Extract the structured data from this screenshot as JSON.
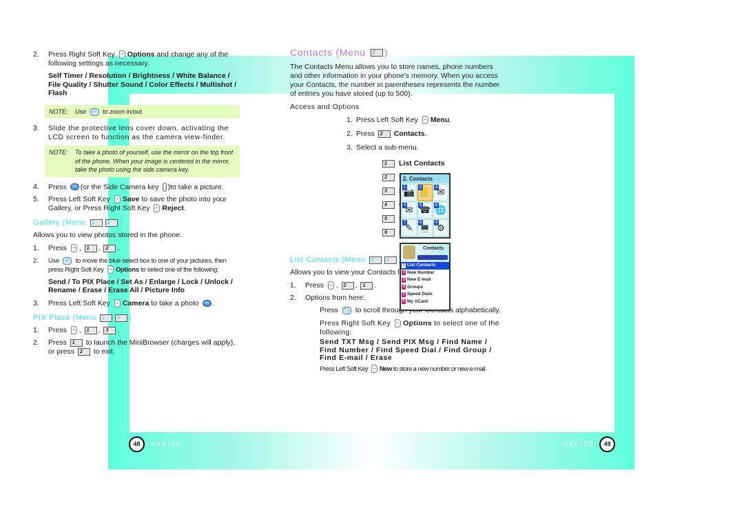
{
  "left_page": {
    "page_number": "48",
    "model": "VX6100",
    "step2": {
      "num": "2.",
      "pre": "Press Right Soft Key",
      "key_label": "Options",
      "post": "and change any of the following settings as necessary.",
      "options": "Self Timer / Resolution / Brightness / White Balance / File Quality / Shutter Sound / Color Effects / Multishot / Flash"
    },
    "note1": {
      "label": "NOTE:",
      "pre": "Use",
      "post": "to zoom in/out."
    },
    "step3": {
      "num": "3.",
      "text": "Slide the protective lens cover down, activating the LCD screen to function as the camera view-finder."
    },
    "note2": {
      "label": "NOTE:",
      "text": "To take a photo of yourself, use the mirror on the top front of the phone. When your image is centered in the mirror, take the photo using the side camera key."
    },
    "step4": {
      "num": "4.",
      "pre": "Press",
      "mid": "(or the Side Camera key",
      "post": ")to take a picture."
    },
    "step5": {
      "num": "5.",
      "pre": "Press Left Soft Key",
      "save": "Save",
      "mid": "to save the photo into your Gallery, or Press Right Soft Key",
      "reject": "Reject",
      "end": "."
    },
    "gallery": {
      "title": "Gallery (Menu",
      "keys": [
        "1",
        "2"
      ],
      "close": ")",
      "desc": "Allows you to view photos stored in the phone.",
      "step1": {
        "num": "1.",
        "pre": "Press",
        "keys": [
          "1",
          "2"
        ]
      },
      "step2": {
        "num": "2.",
        "pre": "Use",
        "mid": "to move the blue select box to one of your pictures, then press Right Soft Key",
        "opt": "Options",
        "post": "to select one of the following:"
      },
      "options": "Send / To PIX Place / Set As / Enlarge / Lock / Unlock / Rename / Erase / Erase All / Picture Info",
      "step3": {
        "num": "3.",
        "pre": "Press Left Soft Key",
        "cam": "Camera",
        "post": "to take a photo"
      }
    },
    "pix_place": {
      "title": "PIX Place (Menu",
      "keys": [
        "1",
        "3"
      ],
      "close": ")",
      "step1": {
        "num": "1.",
        "pre": "Press",
        "keys": [
          "1",
          "3"
        ]
      },
      "step2": {
        "num": "2.",
        "pre": "Press",
        "key": "1",
        "mid": "to launch the MiniBrowser (charges will apply), or press",
        "key2": "2",
        "post": "to exit."
      }
    }
  },
  "right_page": {
    "page_number": "49",
    "model": "VX6100",
    "contacts": {
      "title": "Contacts (Menu",
      "key": "2",
      "close": ")",
      "desc": "The Contacts Menu allows you to store names, phone numbers and other information in your phone's memory. When you access your Contacts, the number in parentheses represents the number of entries you have stored (up to 500).",
      "access_title": "Access and Options",
      "step1": {
        "num": "1.",
        "pre": "Press Left Soft Key",
        "bold": "Menu",
        "end": "."
      },
      "step2": {
        "num": "2.",
        "pre": "Press",
        "key": "2",
        "bold": "Contacts",
        "end": "."
      },
      "step3": {
        "num": "3.",
        "text": "Select a sub-menu."
      },
      "submenu": [
        {
          "key": "1",
          "label": "List Contacts"
        },
        {
          "key": "2",
          "label": "New Number"
        },
        {
          "key": "3",
          "label": "New E-mail"
        },
        {
          "key": "4",
          "label": "Groups"
        },
        {
          "key": "5",
          "label": "Speed Dials"
        },
        {
          "key": "6",
          "label": "My VCard"
        }
      ]
    },
    "phone_grid": {
      "header": "2. Contacts",
      "cells": [
        {
          "n": "1",
          "icon": "camera-icon",
          "glyph": "📷"
        },
        {
          "n": "2",
          "icon": "contacts-book-icon",
          "glyph": "📒",
          "selected": true
        },
        {
          "n": "3",
          "icon": "messages-icon",
          "glyph": "✉"
        },
        {
          "n": "4",
          "icon": "envelope-icon",
          "glyph": "✉"
        },
        {
          "n": "5",
          "icon": "voicemail-icon",
          "glyph": "☎"
        },
        {
          "n": "6",
          "icon": "globe-icon",
          "glyph": "🌐"
        },
        {
          "n": "7",
          "icon": "notepad-icon",
          "glyph": "✎"
        },
        {
          "n": "8",
          "icon": "laptop-icon",
          "glyph": "💻"
        },
        {
          "n": "9",
          "icon": "settings-gears-icon",
          "glyph": "⚙"
        }
      ]
    },
    "phone_list": {
      "title": "Contacts",
      "items": [
        {
          "n": "1",
          "label": "List Contacts",
          "selected": true
        },
        {
          "n": "2",
          "label": "New Number"
        },
        {
          "n": "3",
          "label": "New E-mail"
        },
        {
          "n": "4",
          "label": "Groups"
        },
        {
          "n": "5",
          "label": "Speed Dials"
        },
        {
          "n": "6",
          "label": "My VCard"
        }
      ]
    },
    "list_contacts": {
      "title": "List Contacts (Menu",
      "keys": [
        "2",
        "1"
      ],
      "close": ")",
      "desc": "Allows you to view your Contacts list.",
      "step1": {
        "num": "1.",
        "pre": "Press",
        "keys": [
          "2",
          "1"
        ]
      },
      "step2": {
        "num": "2.",
        "text": "Options from here:"
      },
      "scroll": {
        "pre": "Press",
        "post": "to scroll through your Contacts alphabetically."
      },
      "options_line": {
        "pre": "Press Right Soft Key",
        "bold": "Options",
        "post": "to select one of the following:"
      },
      "options": "Send TXT Msg / Send PIX Msg / Find Name / Find Number / Find Speed Dial / Find Group / Find E-mail / Erase",
      "new_line": {
        "pre": "Press Left Soft Key",
        "bold": "New",
        "post": "to store a new number or new e-mail."
      }
    }
  }
}
